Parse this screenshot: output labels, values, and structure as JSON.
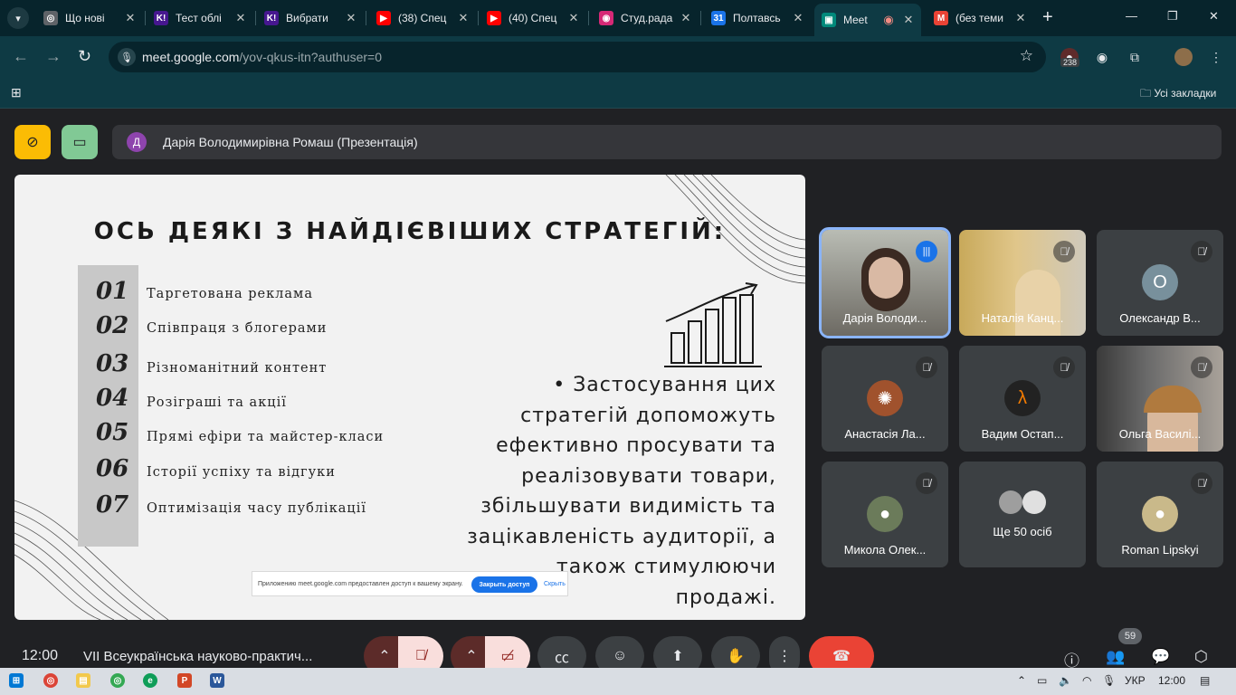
{
  "browser": {
    "tabs": [
      {
        "title": "Що нові",
        "favicon": "chrome-icon",
        "color": "#5f6368"
      },
      {
        "title": "Тест облі",
        "favicon": "kahoot-icon",
        "color": "#46178f"
      },
      {
        "title": "Вибрати",
        "favicon": "kahoot-icon",
        "color": "#46178f"
      },
      {
        "title": "(38) Спец",
        "favicon": "youtube-icon",
        "color": "#ff0000"
      },
      {
        "title": "(40) Спец",
        "favicon": "youtube-icon",
        "color": "#ff0000"
      },
      {
        "title": "Студ.рада",
        "favicon": "instagram-icon",
        "color": "#d62976"
      },
      {
        "title": "Полтавсь",
        "favicon": "calendar-icon",
        "color": "#1a73e8"
      },
      {
        "title": "Meet",
        "favicon": "meet-icon",
        "color": "#00897b"
      },
      {
        "title": "(без теми",
        "favicon": "gmail-icon",
        "color": "#ea4335"
      }
    ],
    "url_host": "meet.google.com",
    "url_path": "/yov-qkus-itn?authuser=0",
    "ext_badge": "238",
    "bookmarks_label": "Усі закладки"
  },
  "meet": {
    "presenter_initial": "Д",
    "presenter_name": "Дарія Володимирівна Ромаш (Презентація)",
    "clock": "12:00",
    "meeting_title": "VII Всеукраїнська науково-практич...",
    "participant_count": "59",
    "tiles": [
      {
        "name": "Дарія Володи...",
        "state": "speaking",
        "kind": "video"
      },
      {
        "name": "Наталія Канц...",
        "state": "muted",
        "kind": "video"
      },
      {
        "name": "Олександр В...",
        "state": "muted",
        "kind": "initial",
        "initial": "О",
        "color": "#78909c"
      },
      {
        "name": "Анастасія Ла...",
        "state": "muted",
        "kind": "avatar",
        "color": "#a0522d"
      },
      {
        "name": "Вадим Остап...",
        "state": "muted",
        "kind": "avatar",
        "color": "#222222"
      },
      {
        "name": "Ольга Василі...",
        "state": "muted",
        "kind": "video"
      },
      {
        "name": "Микола Олек...",
        "state": "muted",
        "kind": "avatar",
        "color": "#6b7b5a"
      },
      {
        "name": "Ще 50 осіб",
        "state": "none",
        "kind": "more"
      },
      {
        "name": "Roman Lipskyi",
        "state": "muted",
        "kind": "avatar",
        "color": "#c9b98a"
      }
    ]
  },
  "slide": {
    "title": "ОСЬ ДЕЯКІ З НАЙДІЄВІШИХ СТРАТЕГІЙ:",
    "items": [
      {
        "num": "01",
        "text": "Таргетована реклама"
      },
      {
        "num": "02",
        "text": "Співпраця з блогерами"
      },
      {
        "num": "03",
        "text": "Різноманітний контент"
      },
      {
        "num": "04",
        "text": "Розіграші та акції"
      },
      {
        "num": "05",
        "text": "Прямі ефіри та майстер-класи"
      },
      {
        "num": "06",
        "text": "Історії успіху та відгуки"
      },
      {
        "num": "07",
        "text": "Оптимізація часу публікації"
      }
    ],
    "bullet": "• Застосування цих стратегій допоможуть ефективно просувати та реалізовувати товари, збільшувати видимість та зацікавленість аудиторії, а також стимулюючи продажі.",
    "share_notice": "Приложению meet.google.com предоставлен доступ к вашему экрану.",
    "share_stop": "Закрыть доступ",
    "share_hide": "Скрыть"
  },
  "taskbar": {
    "lang": "УКР",
    "time": "12:00"
  }
}
